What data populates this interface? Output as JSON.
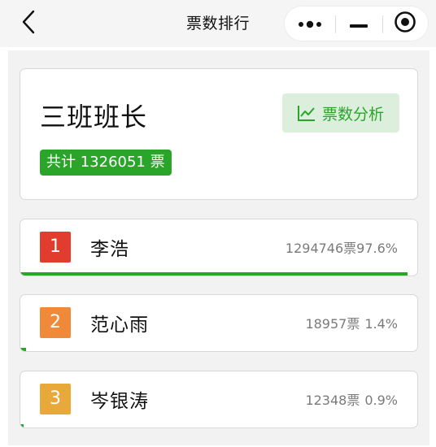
{
  "navbar": {
    "title": "票数排行",
    "back_icon": "chevron-left-icon",
    "capsule_icons": [
      "more-dots-icon",
      "minimize-icon",
      "target-close-icon"
    ]
  },
  "header": {
    "title": "三班班长",
    "total_label": "共计 1326051 票",
    "analysis_label": "票数分析",
    "analysis_icon": "line-chart-icon"
  },
  "colors": {
    "accent_green": "#2aa52a",
    "rank1": "#e23c2e",
    "rank2": "#ee8a3a",
    "rank3": "#e8a93a"
  },
  "rankings": [
    {
      "rank": "1",
      "name": "李浩",
      "votes": "1294746票",
      "percent": "97.6%",
      "share": 0.976
    },
    {
      "rank": "2",
      "name": "范心雨",
      "votes": "18957票",
      "percent": "1.4%",
      "share": 0.014
    },
    {
      "rank": "3",
      "name": "岑银涛",
      "votes": "12348票",
      "percent": "0.9%",
      "share": 0.009
    }
  ]
}
